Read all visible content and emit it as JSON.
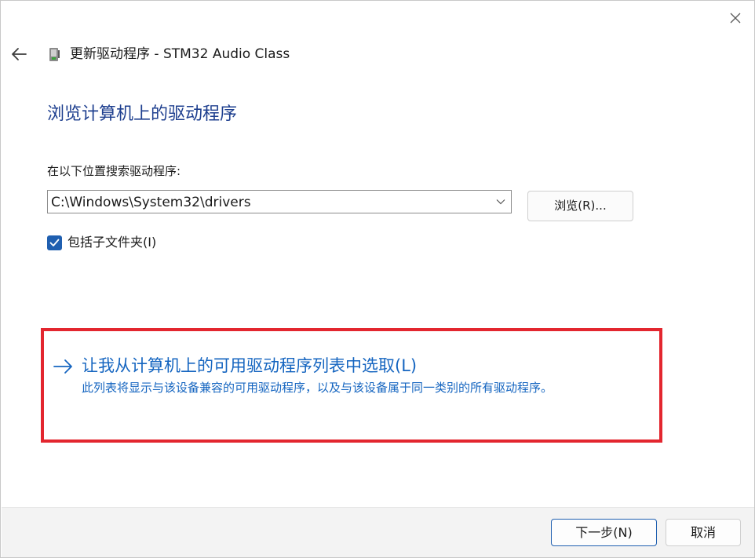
{
  "window": {
    "title": "更新驱动程序 - STM32 Audio Class",
    "title_icon": "device-driver-icon",
    "close_icon": "close-icon",
    "back_icon": "back-arrow-icon"
  },
  "main": {
    "heading": "浏览计算机上的驱动程序",
    "search_label": "在以下位置搜索驱动程序:",
    "path_value": "C:\\Windows\\System32\\drivers",
    "browse_label": "浏览(R)...",
    "include_subfolders": {
      "label": "包括子文件夹(I)",
      "checked": true
    },
    "pick_option": {
      "icon": "arrow-right-icon",
      "title": "让我从计算机上的可用驱动程序列表中选取(L)",
      "description": "此列表将显示与该设备兼容的可用驱动程序，以及与该设备属于同一类别的所有驱动程序。"
    }
  },
  "footer": {
    "next_label": "下一步(N)",
    "cancel_label": "取消"
  },
  "colors": {
    "heading": "#1e3f8f",
    "link": "#1565c0",
    "accent": "#1f5fb0",
    "highlight": "#e3262f",
    "footer_bg": "#f3f3f3"
  }
}
